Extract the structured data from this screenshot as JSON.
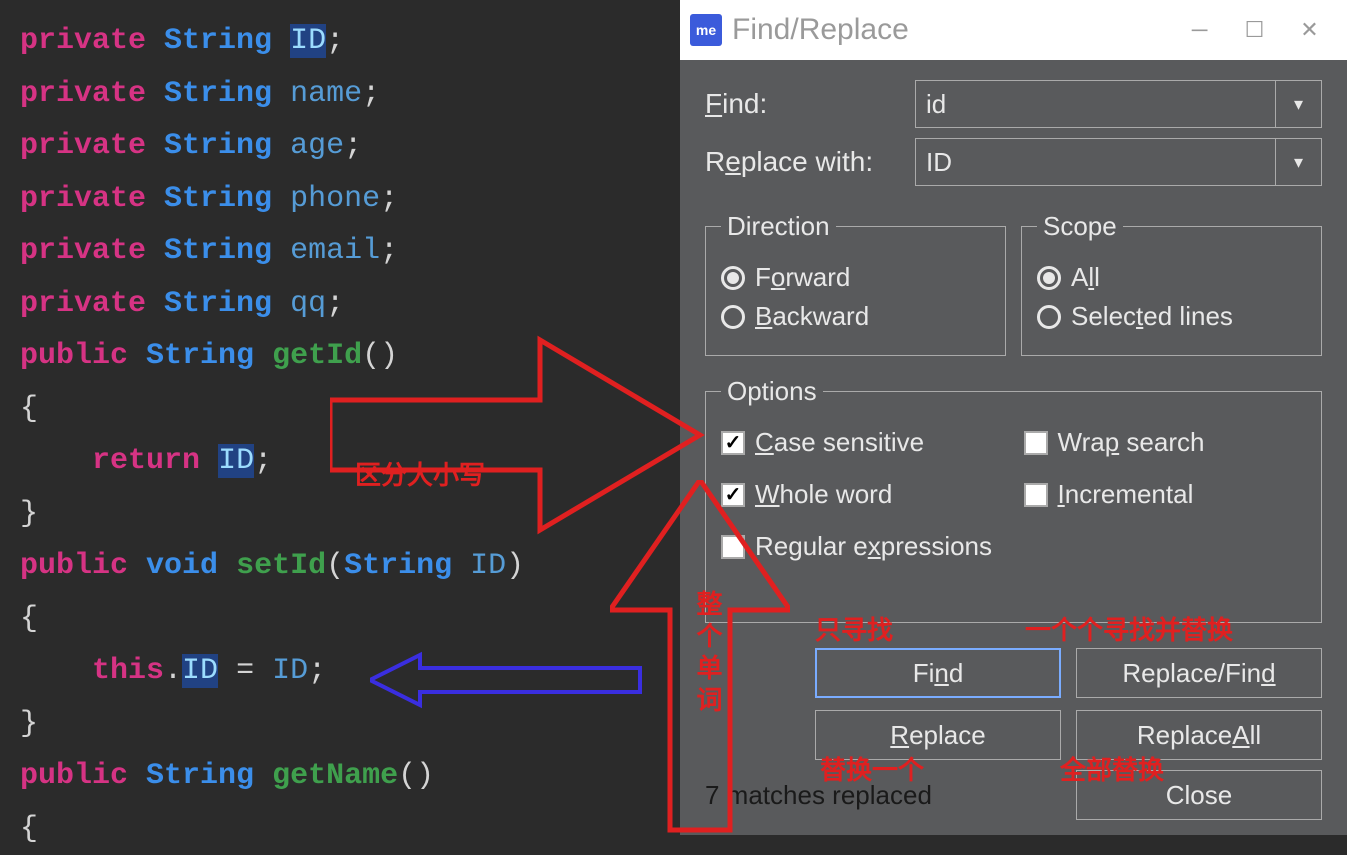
{
  "code": {
    "lines": [
      {
        "tokens": [
          {
            "t": "private",
            "c": "kw-pink"
          },
          {
            "t": " ",
            "c": ""
          },
          {
            "t": "String",
            "c": "type-blue"
          },
          {
            "t": " ",
            "c": ""
          },
          {
            "t": "ID",
            "c": "hl"
          },
          {
            "t": ";",
            "c": "punc"
          }
        ]
      },
      {
        "tokens": [
          {
            "t": "private",
            "c": "kw-pink"
          },
          {
            "t": " ",
            "c": ""
          },
          {
            "t": "String",
            "c": "type-blue"
          },
          {
            "t": " ",
            "c": ""
          },
          {
            "t": "name",
            "c": "ident-blue"
          },
          {
            "t": ";",
            "c": "punc"
          }
        ]
      },
      {
        "tokens": [
          {
            "t": "private",
            "c": "kw-pink"
          },
          {
            "t": " ",
            "c": ""
          },
          {
            "t": "String",
            "c": "type-blue"
          },
          {
            "t": " ",
            "c": ""
          },
          {
            "t": "age",
            "c": "ident-blue"
          },
          {
            "t": ";",
            "c": "punc"
          }
        ]
      },
      {
        "tokens": [
          {
            "t": "private",
            "c": "kw-pink"
          },
          {
            "t": " ",
            "c": ""
          },
          {
            "t": "String",
            "c": "type-blue"
          },
          {
            "t": " ",
            "c": ""
          },
          {
            "t": "phone",
            "c": "ident-blue"
          },
          {
            "t": ";",
            "c": "punc"
          }
        ]
      },
      {
        "tokens": [
          {
            "t": "private",
            "c": "kw-pink"
          },
          {
            "t": " ",
            "c": ""
          },
          {
            "t": "String",
            "c": "type-blue"
          },
          {
            "t": " ",
            "c": ""
          },
          {
            "t": "email",
            "c": "ident-blue"
          },
          {
            "t": ";",
            "c": "punc"
          }
        ]
      },
      {
        "tokens": [
          {
            "t": "private",
            "c": "kw-pink"
          },
          {
            "t": " ",
            "c": ""
          },
          {
            "t": "String",
            "c": "type-blue"
          },
          {
            "t": " ",
            "c": ""
          },
          {
            "t": "qq",
            "c": "ident-blue"
          },
          {
            "t": ";",
            "c": "punc"
          }
        ]
      },
      {
        "tokens": [
          {
            "t": "public",
            "c": "kw-pink"
          },
          {
            "t": " ",
            "c": ""
          },
          {
            "t": "String",
            "c": "type-blue"
          },
          {
            "t": " ",
            "c": ""
          },
          {
            "t": "getId",
            "c": "fn-green"
          },
          {
            "t": "()",
            "c": "punc"
          }
        ]
      },
      {
        "tokens": [
          {
            "t": "{",
            "c": "punc"
          }
        ]
      },
      {
        "tokens": [
          {
            "t": "    ",
            "c": ""
          },
          {
            "t": "return",
            "c": "kw-pink"
          },
          {
            "t": " ",
            "c": ""
          },
          {
            "t": "ID",
            "c": "hl"
          },
          {
            "t": ";",
            "c": "punc"
          }
        ]
      },
      {
        "tokens": [
          {
            "t": "}",
            "c": "punc"
          }
        ]
      },
      {
        "tokens": [
          {
            "t": "public",
            "c": "kw-pink"
          },
          {
            "t": " ",
            "c": ""
          },
          {
            "t": "void",
            "c": "type-blue"
          },
          {
            "t": " ",
            "c": ""
          },
          {
            "t": "setId",
            "c": "fn-green"
          },
          {
            "t": "(",
            "c": "punc"
          },
          {
            "t": "String",
            "c": "type-blue"
          },
          {
            "t": " ",
            "c": ""
          },
          {
            "t": "ID",
            "c": "ident-blue"
          },
          {
            "t": ")",
            "c": "punc"
          }
        ]
      },
      {
        "tokens": [
          {
            "t": "{",
            "c": "punc"
          }
        ]
      },
      {
        "tokens": [
          {
            "t": "    ",
            "c": ""
          },
          {
            "t": "this",
            "c": "kw-pink"
          },
          {
            "t": ".",
            "c": "punc"
          },
          {
            "t": "ID",
            "c": "hl"
          },
          {
            "t": " = ",
            "c": "punc"
          },
          {
            "t": "ID",
            "c": "ident-blue"
          },
          {
            "t": ";",
            "c": "punc"
          }
        ]
      },
      {
        "tokens": [
          {
            "t": "}",
            "c": "punc"
          }
        ]
      },
      {
        "tokens": [
          {
            "t": "public",
            "c": "kw-pink"
          },
          {
            "t": " ",
            "c": ""
          },
          {
            "t": "String",
            "c": "type-blue"
          },
          {
            "t": " ",
            "c": ""
          },
          {
            "t": "getName",
            "c": "fn-green"
          },
          {
            "t": "()",
            "c": "punc"
          }
        ]
      },
      {
        "tokens": [
          {
            "t": "{",
            "c": "punc"
          }
        ]
      }
    ]
  },
  "dialog": {
    "app_icon_text": "me",
    "title": "Find/Replace",
    "find_label": "Find:",
    "replace_label": "Replace with:",
    "find_value": "id",
    "replace_value": "ID",
    "direction": {
      "legend": "Direction",
      "forward": "Forward",
      "backward": "Backward",
      "selected": "forward"
    },
    "scope": {
      "legend": "Scope",
      "all": "All",
      "selected_lines": "Selected lines",
      "selected": "all"
    },
    "options": {
      "legend": "Options",
      "case_sensitive": {
        "label": "Case sensitive",
        "checked": true
      },
      "wrap_search": {
        "label": "Wrap search",
        "checked": false
      },
      "whole_word": {
        "label": "Whole word",
        "checked": true
      },
      "incremental": {
        "label": "Incremental",
        "checked": false
      },
      "regex": {
        "label": "Regular expressions",
        "checked": false
      }
    },
    "buttons": {
      "find": "Find",
      "replace_find": "Replace/Find",
      "replace": "Replace",
      "replace_all": "Replace All",
      "close": "Close"
    },
    "status": "7 matches replaced"
  },
  "annotations": {
    "case_sensitive_note": "区分大小写",
    "whole_word_note": "整个单词",
    "find_note": "只寻找",
    "replace_find_note": "一个个寻找并替换",
    "replace_note": "替换一个",
    "replace_all_note": "全部替换"
  }
}
